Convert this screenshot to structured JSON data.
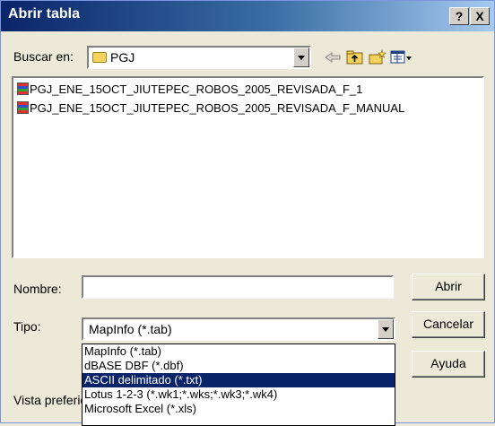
{
  "window": {
    "title": "Abrir tabla",
    "help_label": "?",
    "close_label": "X"
  },
  "lookin": {
    "label": "Buscar en:",
    "value": "PGJ",
    "icons": [
      "back-arrow-icon",
      "up-folder-icon",
      "new-folder-icon",
      "view-menu-icon"
    ]
  },
  "files": [
    "PGJ_ENE_15OCT_JIUTEPEC_ROBOS_2005_REVISADA_F_1",
    "PGJ_ENE_15OCT_JIUTEPEC_ROBOS_2005_REVISADA_F_MANUAL"
  ],
  "name_field": {
    "label": "Nombre:",
    "value": ""
  },
  "type_field": {
    "label": "Tipo:",
    "value": "MapInfo (*.tab)",
    "options": [
      "MapInfo (*.tab)",
      "dBASE DBF (*.dbf)",
      "ASCII delimitado (*.txt)",
      "Lotus 1-2-3 (*.wk1;*.wks;*.wk3;*.wk4)",
      "Microsoft Excel (*.xls)"
    ],
    "highlighted_index": 2
  },
  "preview_label": "Vista preferid",
  "buttons": {
    "open": "Abrir",
    "cancel": "Cancelar",
    "help": "Ayuda"
  },
  "colors": {
    "title_start": "#0a246a",
    "title_end": "#a6caf0",
    "selection": "#0a246a",
    "folder": "#f2d35b"
  }
}
